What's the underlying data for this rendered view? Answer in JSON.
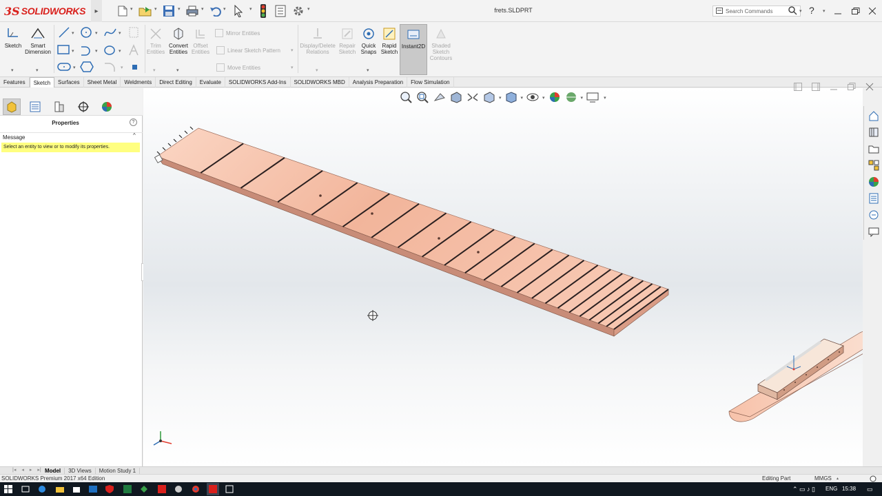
{
  "app": {
    "title": "frets.SLDPRT",
    "search_placeholder": "Search Commands",
    "help": "?"
  },
  "logo": {
    "ds": "3S",
    "name": "SOLIDWORKS"
  },
  "ribbon": {
    "sketch": "Sketch",
    "smart_dimension": "Smart Dimension",
    "trim_entities": "Trim Entities",
    "convert_entities": "Convert Entities",
    "offset_entities": "Offset Entities",
    "mirror_entities": "Mirror Entities",
    "linear_sketch_pattern": "Linear Sketch Pattern",
    "move_entities": "Move Entities",
    "display_delete_relations": "Display/Delete Relations",
    "repair_sketch": "Repair Sketch",
    "quick_snaps": "Quick Snaps",
    "rapid_sketch": "Rapid Sketch",
    "instant2d": "Instant2D",
    "shaded_sketch_contours": "Shaded Sketch Contours"
  },
  "tabs": [
    "Features",
    "Sketch",
    "Surfaces",
    "Sheet Metal",
    "Weldments",
    "Direct Editing",
    "Evaluate",
    "SOLIDWORKS Add-Ins",
    "SOLIDWORKS MBD",
    "Analysis Preparation",
    "Flow Simulation"
  ],
  "active_tab": "Sketch",
  "panel": {
    "title": "Properties",
    "message_header": "Message",
    "message": "Select an entity to view or to modify its properties."
  },
  "bottom_tabs": [
    "Model",
    "3D Views",
    "Motion Study 1"
  ],
  "status": {
    "edition": "SOLIDWORKS Premium 2017 x64 Edition",
    "mode": "Editing Part",
    "units": "MMGS"
  },
  "taskbar": {
    "lang": "ENG",
    "time": "15:38"
  },
  "colors": {
    "brand": "#d9201c",
    "wood": "#f0b49a",
    "highlight": "#ffff80"
  },
  "icons": [
    "new-icon",
    "open-icon",
    "save-icon",
    "print-icon",
    "undo-icon",
    "select-icon",
    "rebuild-icon",
    "options-icon",
    "settings-icon"
  ]
}
